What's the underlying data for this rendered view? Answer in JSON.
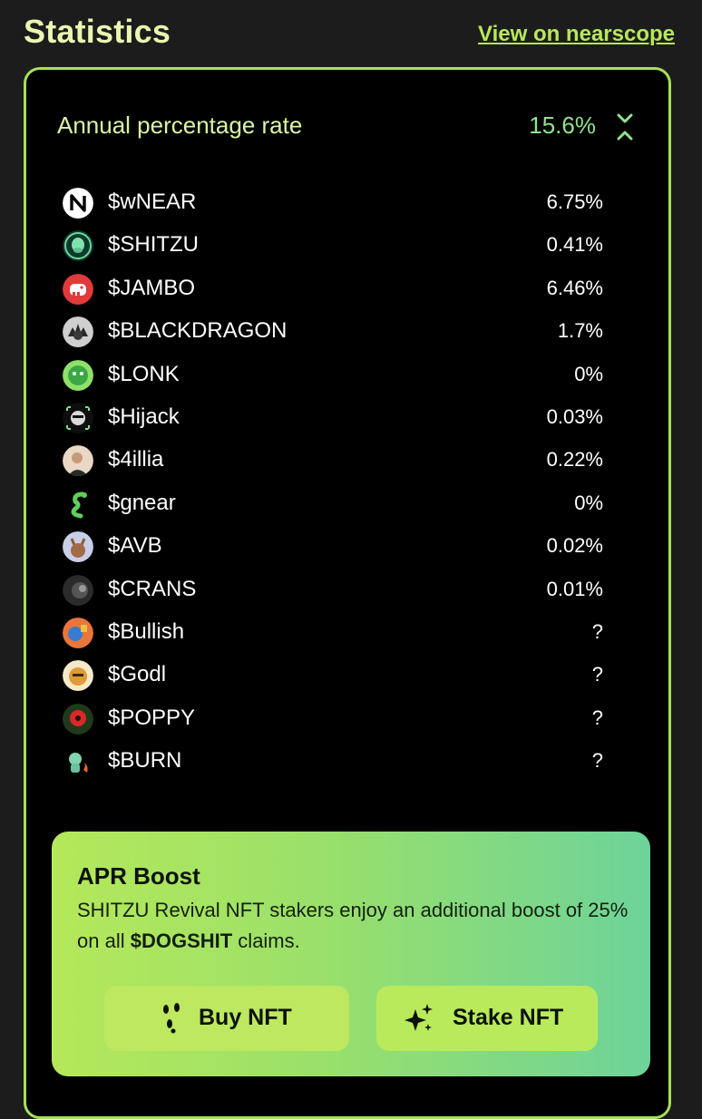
{
  "header": {
    "title": "Statistics",
    "link_label": "View on nearscope"
  },
  "apr": {
    "label": "Annual percentage rate",
    "value": "15.6%"
  },
  "tokens": [
    {
      "name": "$wNEAR",
      "apr": "6.75%",
      "icon": "near-logo-icon"
    },
    {
      "name": "$SHITZU",
      "apr": "0.41%",
      "icon": "shitzu-icon"
    },
    {
      "name": "$JAMBO",
      "apr": "6.46%",
      "icon": "jambo-icon"
    },
    {
      "name": "$BLACKDRAGON",
      "apr": "1.7%",
      "icon": "blackdragon-icon"
    },
    {
      "name": "$LONK",
      "apr": "0%",
      "icon": "lonk-icon"
    },
    {
      "name": "$Hijack",
      "apr": "0.03%",
      "icon": "hijack-icon"
    },
    {
      "name": "$4illia",
      "apr": "0.22%",
      "icon": "4illia-icon"
    },
    {
      "name": "$gnear",
      "apr": "0%",
      "icon": "gnear-icon"
    },
    {
      "name": "$AVB",
      "apr": "0.02%",
      "icon": "avb-icon"
    },
    {
      "name": "$CRANS",
      "apr": "0.01%",
      "icon": "crans-icon"
    },
    {
      "name": "$Bullish",
      "apr": "?",
      "icon": "bullish-icon"
    },
    {
      "name": "$Godl",
      "apr": "?",
      "icon": "godl-icon"
    },
    {
      "name": "$POPPY",
      "apr": "?",
      "icon": "poppy-icon"
    },
    {
      "name": "$BURN",
      "apr": "?",
      "icon": "burn-icon"
    }
  ],
  "boost": {
    "title": "APR Boost",
    "text_before": "SHITZU Revival NFT stakers enjoy an additional boost of 25% on all ",
    "text_bold": "$DOGSHIT",
    "text_after": " claims.",
    "buy_label": "Buy NFT",
    "stake_label": "Stake NFT"
  },
  "colors": {
    "accent": "#a6e05a",
    "title": "#e9f7b0",
    "apr_value": "#8fe38a"
  }
}
